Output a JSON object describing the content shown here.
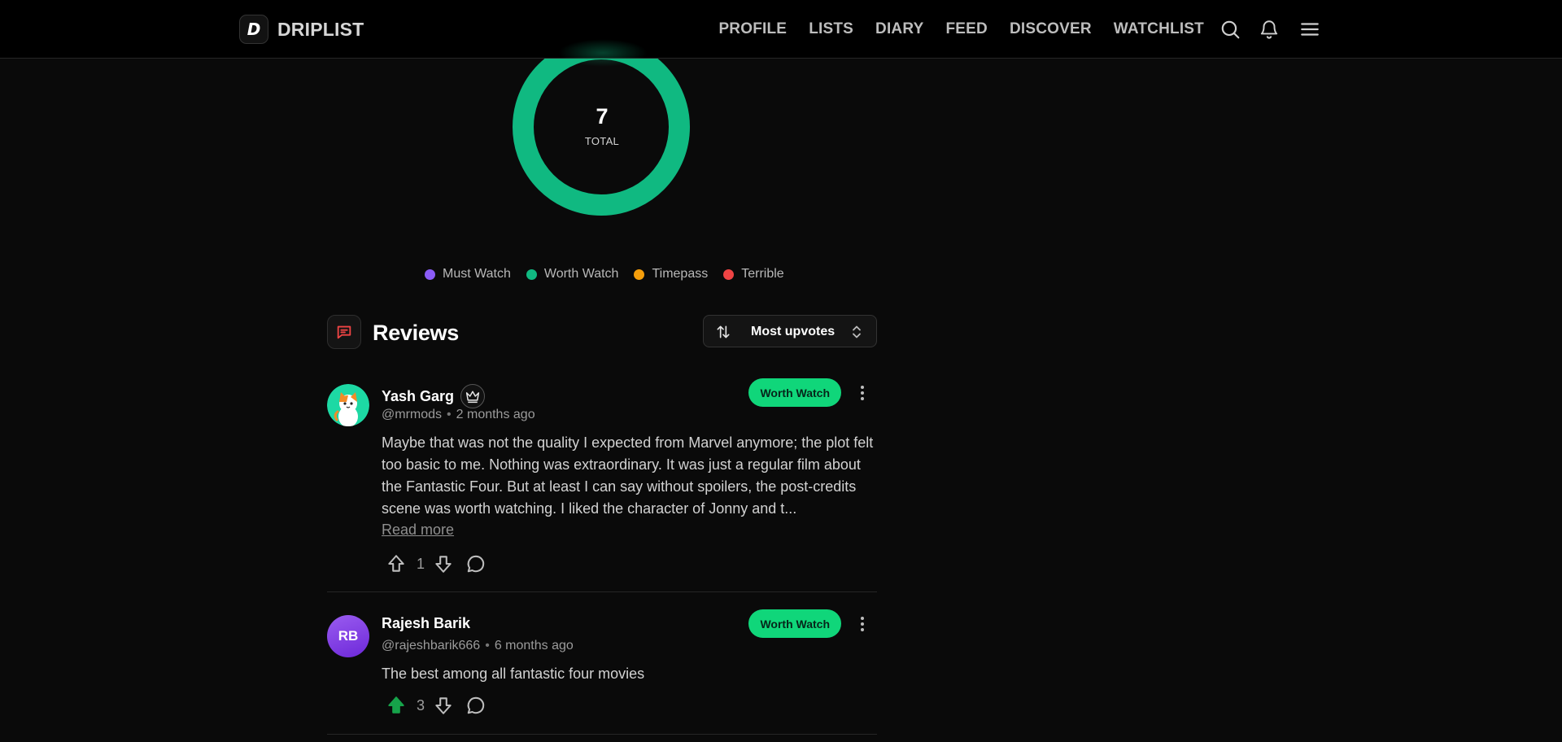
{
  "brand": {
    "logo_letter": "D",
    "name": "DRIPLIST"
  },
  "nav": {
    "links": [
      "PROFILE",
      "LISTS",
      "DIARY",
      "FEED",
      "DISCOVER",
      "WATCHLIST"
    ],
    "icons": [
      "search-icon",
      "bell-icon",
      "menu-icon"
    ]
  },
  "ratings": {
    "total_value": "7",
    "total_label": "TOTAL",
    "breakdown": [
      {
        "label": "Must Watch",
        "color": "#8b5cf6",
        "count": 0
      },
      {
        "label": "Worth Watch",
        "color": "#10b981",
        "count": 7
      },
      {
        "label": "Timepass",
        "color": "#f59e0b",
        "count": 0
      },
      {
        "label": "Terrible",
        "color": "#ef4444",
        "count": 0
      }
    ]
  },
  "reviews": {
    "title": "Reviews",
    "sort_label": "Most upvotes",
    "items": [
      {
        "name": "Yash Garg",
        "handle": "@mrmods",
        "time": "2 months ago",
        "badge": "Worth Watch",
        "text": "Maybe that was not the quality I expected from Marvel anymore; the plot felt too basic to me. Nothing was extraordinary. It was just a regular film about the Fantastic Four. But at least I can say without spoilers, the post-credits scene was worth watching. I liked the character of Jonny and t...",
        "read_more": "Read more",
        "upvotes": "1",
        "upvoted": false
      },
      {
        "name": "Rajesh Barik",
        "initials": "RB",
        "handle": "@rajeshbarik666",
        "time": "6 months ago",
        "badge": "Worth Watch",
        "text": "The best among all fantastic four movies",
        "upvotes": "3",
        "upvoted": true
      }
    ]
  },
  "colors": {
    "accent_green": "#10d67a",
    "donut_green": "#10b981",
    "upvote_active": "#16a34a"
  }
}
